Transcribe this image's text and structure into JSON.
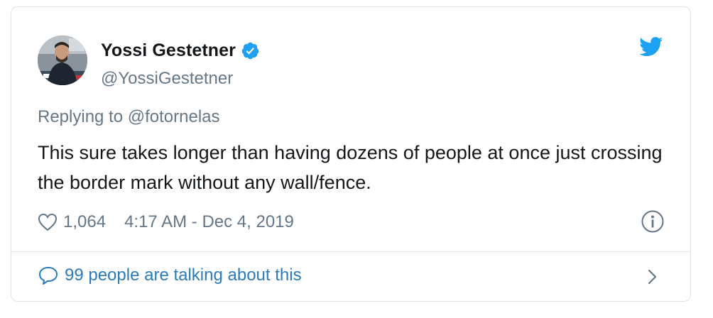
{
  "author": {
    "name": "Yossi Gestetner",
    "handle": "@YossiGestetner",
    "verified": true
  },
  "reply": {
    "prefix": "Replying to",
    "mention": "@fotornelas"
  },
  "tweet": {
    "text": "This sure takes longer than having dozens of people at once just crossing the border mark without any wall/fence."
  },
  "meta": {
    "likes": "1,064",
    "timestamp": "4:17 AM - Dec 4, 2019"
  },
  "footer": {
    "conversation_label": "99 people are talking about this"
  },
  "icons": {
    "brand": "twitter-bird-icon",
    "verified": "verified-badge-icon",
    "like": "heart-icon",
    "info": "info-icon",
    "conversation": "speech-bubble-icon",
    "chevron": "chevron-right-icon"
  },
  "colors": {
    "twitter_blue": "#1da1f2",
    "link_blue": "#2b7bb9",
    "text": "#14171a",
    "muted": "#657786",
    "border": "#dfe3e8"
  }
}
